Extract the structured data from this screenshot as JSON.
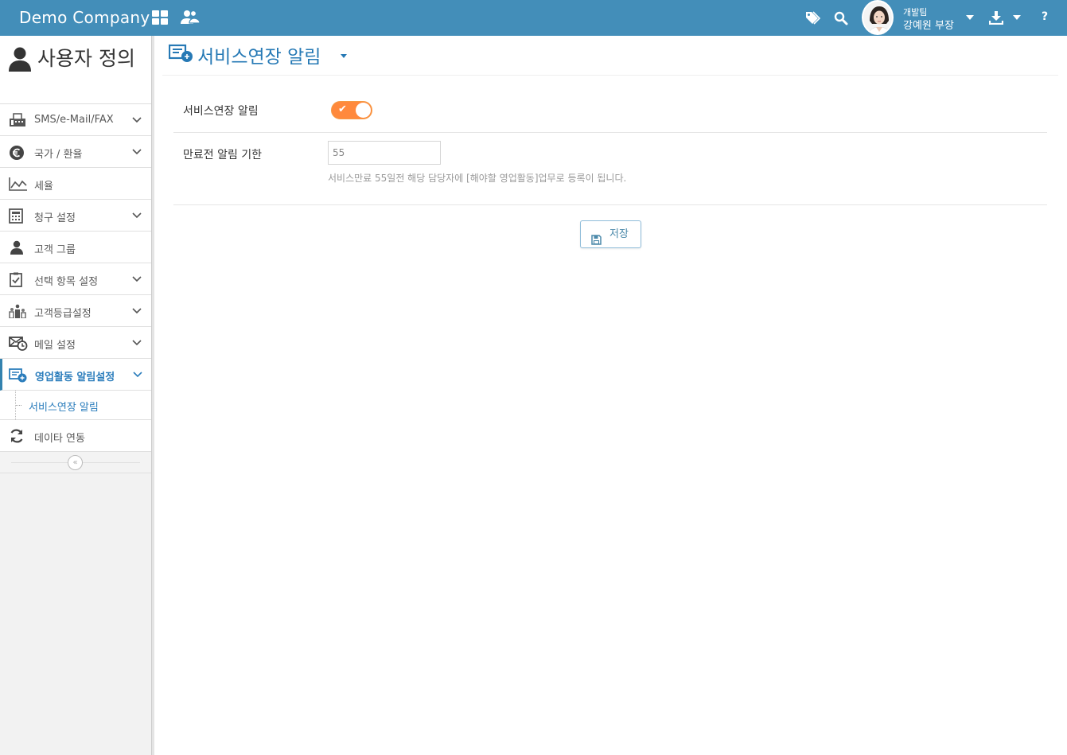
{
  "header": {
    "brand": "Demo Company",
    "user_team": "개발팀",
    "user_name": "강예원 부장",
    "help": "?"
  },
  "sidebar": {
    "title": "사용자 정의",
    "items": [
      {
        "label": "SMS/e-Mail/FAX",
        "icon": "fax-icon",
        "has_children": true
      },
      {
        "label": "국가 / 환율",
        "icon": "euro-icon",
        "has_children": true
      },
      {
        "label": "세율",
        "icon": "line-chart-icon",
        "has_children": false
      },
      {
        "label": "청구 설정",
        "icon": "calculator-icon",
        "has_children": true
      },
      {
        "label": "고객 그룹",
        "icon": "user-icon",
        "has_children": false
      },
      {
        "label": "선택 항목 설정",
        "icon": "checklist-icon",
        "has_children": true
      },
      {
        "label": "고객등급설정",
        "icon": "ranking-icon",
        "has_children": true
      },
      {
        "label": "메일 설정",
        "icon": "mail-clock-icon",
        "has_children": true
      },
      {
        "label": "영업활동 알림설정",
        "icon": "notification-icon",
        "has_children": true,
        "active": true
      },
      {
        "label": "데이타 연동",
        "icon": "refresh-icon",
        "has_children": false
      }
    ],
    "sub_item": "서비스연장 알림"
  },
  "page": {
    "title": "서비스연장 알림",
    "toggle_label": "서비스연장 알림",
    "toggle_on": true,
    "deadline_label": "만료전 알림 기한",
    "deadline_value": "55",
    "help_text": "서비스만료 55일전 해당 담당자에 [해야할 영업활동]업무로 등록이 됩니다.",
    "save_label": "저장"
  },
  "colors": {
    "topbar": "#438eb9",
    "accent": "#2679b5",
    "toggle": "#ff893c"
  }
}
